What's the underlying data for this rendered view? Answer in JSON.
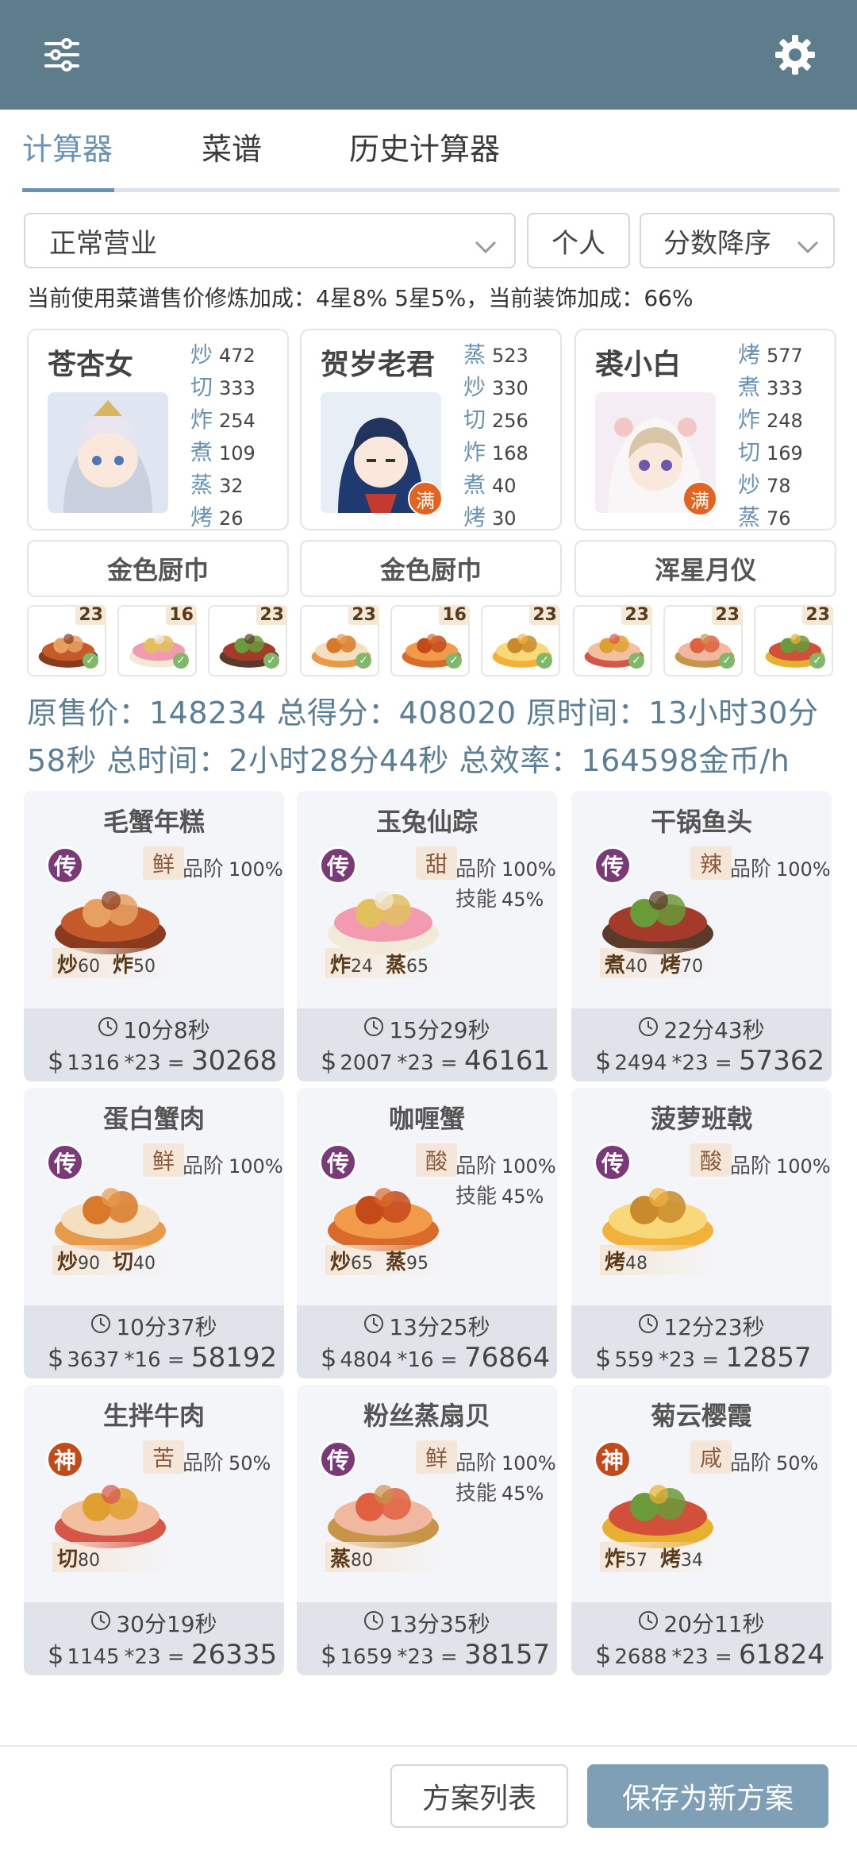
{
  "tabs": [
    {
      "label": "计算器"
    },
    {
      "label": "菜谱"
    },
    {
      "label": "历史计算器"
    }
  ],
  "filters": {
    "mode": "正常营业",
    "scope": "个人",
    "sort": "分数降序"
  },
  "note": "当前使用菜谱售价修炼加成：4星8% 5星5%，当前装饰加成：66%",
  "chefs": [
    {
      "name": "苍杏女",
      "full": false,
      "skills": [
        {
          "k": "炒",
          "v": "472"
        },
        {
          "k": "切",
          "v": "333"
        },
        {
          "k": "炸",
          "v": "254"
        },
        {
          "k": "煮",
          "v": "109"
        },
        {
          "k": "蒸",
          "v": "32"
        },
        {
          "k": "烤",
          "v": "26"
        }
      ]
    },
    {
      "name": "贺岁老君",
      "full": true,
      "full_badge": "满",
      "skills": [
        {
          "k": "蒸",
          "v": "523"
        },
        {
          "k": "炒",
          "v": "330"
        },
        {
          "k": "切",
          "v": "256"
        },
        {
          "k": "炸",
          "v": "168"
        },
        {
          "k": "煮",
          "v": "40"
        },
        {
          "k": "烤",
          "v": "30"
        }
      ]
    },
    {
      "name": "裘小白",
      "full": true,
      "full_badge": "满",
      "skills": [
        {
          "k": "烤",
          "v": "577"
        },
        {
          "k": "煮",
          "v": "333"
        },
        {
          "k": "炸",
          "v": "248"
        },
        {
          "k": "切",
          "v": "169"
        },
        {
          "k": "炒",
          "v": "78"
        },
        {
          "k": "蒸",
          "v": "76"
        }
      ]
    }
  ],
  "equipment": [
    "金色厨巾",
    "金色厨巾",
    "浑星月仪"
  ],
  "dish_counts": [
    "23",
    "16",
    "23",
    "23",
    "16",
    "23",
    "23",
    "23",
    "23"
  ],
  "summary": "原售价：148234 总得分：408020 原时间：13小时30分58秒 总时间：2小时28分44秒 总效率：164598金币/h",
  "grade_label": "品阶",
  "skill_label": "技能",
  "recipes": [
    {
      "name": "毛蟹年糕",
      "rarity": "传",
      "flavor": "鲜",
      "grade": "100%",
      "skill": "",
      "needs": [
        {
          "k": "炒",
          "v": "60"
        },
        {
          "k": "炸",
          "v": "50"
        }
      ],
      "time": "10分8秒",
      "price": "1316",
      "qty": "*23",
      "total": "30268"
    },
    {
      "name": "玉兔仙踪",
      "rarity": "传",
      "flavor": "甜",
      "grade": "100%",
      "skill": "45%",
      "needs": [
        {
          "k": "炸",
          "v": "24"
        },
        {
          "k": "蒸",
          "v": "65"
        }
      ],
      "time": "15分29秒",
      "price": "2007",
      "qty": "*23",
      "total": "46161"
    },
    {
      "name": "干锅鱼头",
      "rarity": "传",
      "flavor": "辣",
      "grade": "100%",
      "skill": "",
      "needs": [
        {
          "k": "煮",
          "v": "40"
        },
        {
          "k": "烤",
          "v": "70"
        }
      ],
      "time": "22分43秒",
      "price": "2494",
      "qty": "*23",
      "total": "57362"
    },
    {
      "name": "蛋白蟹肉",
      "rarity": "传",
      "flavor": "鲜",
      "grade": "100%",
      "skill": "",
      "needs": [
        {
          "k": "炒",
          "v": "90"
        },
        {
          "k": "切",
          "v": "40"
        }
      ],
      "time": "10分37秒",
      "price": "3637",
      "qty": "*16",
      "total": "58192"
    },
    {
      "name": "咖喱蟹",
      "rarity": "传",
      "flavor": "酸",
      "grade": "100%",
      "skill": "45%",
      "needs": [
        {
          "k": "炒",
          "v": "65"
        },
        {
          "k": "蒸",
          "v": "95"
        }
      ],
      "time": "13分25秒",
      "price": "4804",
      "qty": "*16",
      "total": "76864"
    },
    {
      "name": "菠萝班戟",
      "rarity": "传",
      "flavor": "酸",
      "grade": "100%",
      "skill": "",
      "needs": [
        {
          "k": "烤",
          "v": "48"
        }
      ],
      "time": "12分23秒",
      "price": "559",
      "qty": "*23",
      "total": "12857"
    },
    {
      "name": "生拌牛肉",
      "rarity": "神",
      "flavor": "苦",
      "grade": "50%",
      "skill": "",
      "needs": [
        {
          "k": "切",
          "v": "80"
        }
      ],
      "time": "30分19秒",
      "price": "1145",
      "qty": "*23",
      "total": "26335"
    },
    {
      "name": "粉丝蒸扇贝",
      "rarity": "传",
      "flavor": "鲜",
      "grade": "100%",
      "skill": "45%",
      "needs": [
        {
          "k": "蒸",
          "v": "80"
        }
      ],
      "time": "13分35秒",
      "price": "1659",
      "qty": "*23",
      "total": "38157"
    },
    {
      "name": "菊云樱霞",
      "rarity": "神",
      "flavor": "咸",
      "grade": "50%",
      "skill": "",
      "needs": [
        {
          "k": "炸",
          "v": "57"
        },
        {
          "k": "烤",
          "v": "34"
        }
      ],
      "time": "20分11秒",
      "price": "2688",
      "qty": "*23",
      "total": "61824"
    }
  ],
  "footer": {
    "plan_list": "方案列表",
    "save_new": "保存为新方案"
  },
  "colors": {
    "topbar": "#5d7d8d",
    "accent": "#6a93b3",
    "rarity_chuan": "#7a3a78",
    "rarity_shen": "#c44a1a"
  }
}
